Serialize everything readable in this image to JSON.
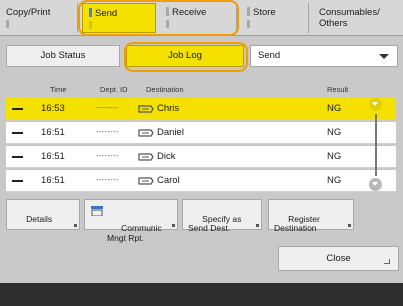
{
  "tabs": [
    {
      "label": "Copy/Print"
    },
    {
      "label": "Send"
    },
    {
      "label": "Receive"
    },
    {
      "label": "Store"
    },
    {
      "label": "Consumables/ Others"
    }
  ],
  "subtabs": {
    "job_status": "Job Status",
    "job_log": "Job Log"
  },
  "filter": {
    "selected": "Send"
  },
  "table": {
    "headers": {
      "time": "Time",
      "dept": "Dept. ID",
      "destination": "Destination",
      "result": "Result"
    },
    "rows": [
      {
        "time": "16:53",
        "dept": "--------",
        "destination": "Chris",
        "result": "NG"
      },
      {
        "time": "16:51",
        "dept": "--------",
        "destination": "Daniel",
        "result": "NG"
      },
      {
        "time": "16:51",
        "dept": "--------",
        "destination": "Dick",
        "result": "NG"
      },
      {
        "time": "16:51",
        "dept": "--------",
        "destination": "Carol",
        "result": "NG"
      }
    ]
  },
  "actions": {
    "details": "Details",
    "comm_report": "Communic\nMngt Rpt.",
    "specify": "Specify as\nSend Dest.",
    "register": "Register\nDestination"
  },
  "close_label": "Close",
  "colors": {
    "selected": "#f4e100",
    "highlight_ring": "#f39b00"
  }
}
